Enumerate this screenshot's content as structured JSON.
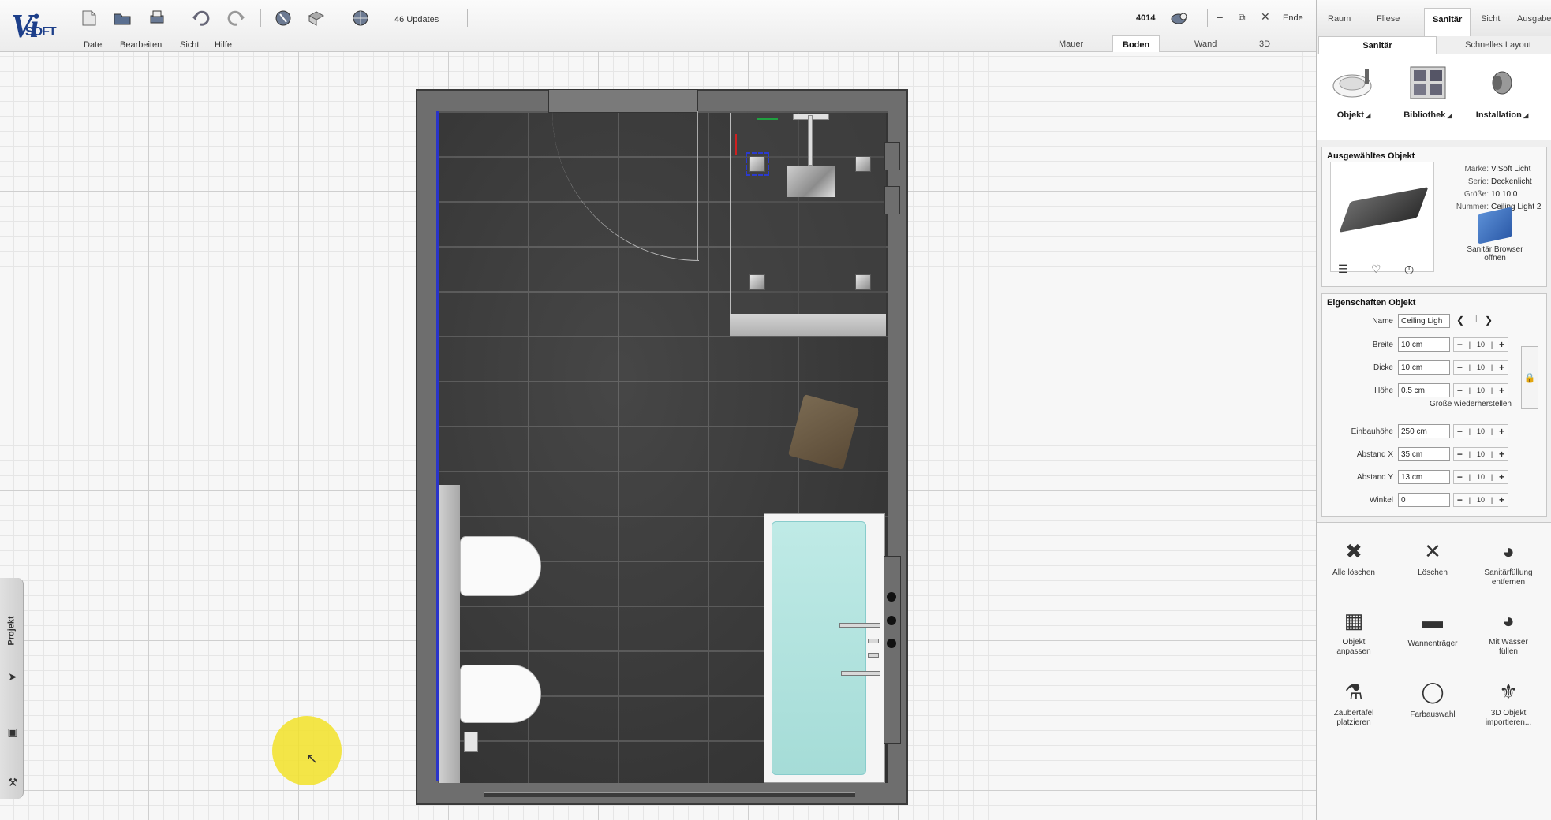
{
  "app": {
    "logo_text_v": "Vi",
    "logo_text_soft": "SOFT",
    "updates_label": "46 Updates",
    "counter": "4014",
    "exit_label": "Ende"
  },
  "menu": [
    "Datei",
    "Bearbeiten",
    "Sicht",
    "Hilfe"
  ],
  "view_tabs": [
    "Mauer",
    "Boden",
    "Wand",
    "3D"
  ],
  "view_tab_active": "Boden",
  "right_tabs": [
    "Raum",
    "Fliese",
    "Sanitär",
    "Sicht",
    "Ausgabe"
  ],
  "right_tab_active": "Sanitär",
  "sub_tabs": [
    "Sanitär",
    "Schnelles Layout"
  ],
  "ribbon": [
    {
      "label": "Objekt",
      "icon": "sink-icon"
    },
    {
      "label": "Bibliothek",
      "icon": "library-icon"
    },
    {
      "label": "Installation",
      "icon": "pipe-icon"
    }
  ],
  "selected": {
    "title": "Ausgewähltes Objekt",
    "meta": [
      {
        "k": "Marke:",
        "v": "ViSoft Licht"
      },
      {
        "k": "Serie:",
        "v": "Deckenlicht"
      },
      {
        "k": "Größe:",
        "v": "10;10;0"
      },
      {
        "k": "Nummer:",
        "v": "Ceiling Light 2"
      }
    ],
    "browser_label_1": "Sanitär Browser",
    "browser_label_2": "öffnen",
    "icons": [
      "list-icon",
      "heart-icon",
      "clock-icon"
    ]
  },
  "properties": {
    "title": "Eigenschaften Objekt",
    "name_label": "Name",
    "name_value": "Ceiling Ligh",
    "rows1": [
      {
        "label": "Breite",
        "value": "10 cm",
        "step": "10"
      },
      {
        "label": "Dicke",
        "value": "10 cm",
        "step": "10"
      },
      {
        "label": "Höhe",
        "value": "0.5 cm",
        "step": "10"
      }
    ],
    "restore_label": "Größe wiederherstellen",
    "rows2": [
      {
        "label": "Einbauhöhe",
        "value": "250 cm",
        "step": "10"
      },
      {
        "label": "Abstand X",
        "value": "35 cm",
        "step": "10"
      },
      {
        "label": "Abstand Y",
        "value": "13 cm",
        "step": "10"
      },
      {
        "label": "Winkel",
        "value": "0",
        "step": "10"
      }
    ]
  },
  "actions": [
    {
      "l1": "Alle löschen",
      "l2": "",
      "icon": "delete-all-icon"
    },
    {
      "l1": "Löschen",
      "l2": "",
      "icon": "delete-icon"
    },
    {
      "l1": "Sanitärfüllung",
      "l2": "entfernen",
      "icon": "remove-fill-icon"
    },
    {
      "l1": "Objekt",
      "l2": "anpassen",
      "icon": "adjust-object-icon"
    },
    {
      "l1": "Wannenträger",
      "l2": "",
      "icon": "tub-support-icon"
    },
    {
      "l1": "Mit Wasser",
      "l2": "füllen",
      "icon": "fill-water-icon"
    },
    {
      "l1": "Zaubertafel",
      "l2": "platzieren",
      "icon": "magic-board-icon"
    },
    {
      "l1": "Farbauswahl",
      "l2": "",
      "icon": "color-picker-icon"
    },
    {
      "l1": "3D Objekt",
      "l2": "importieren...",
      "icon": "import-3d-icon"
    }
  ],
  "left_tab": "Projekt",
  "colors": {
    "accent_blue": "#1d3f8a",
    "selection_blue": "#2a3ad0",
    "highlight_yellow": "#f2e228"
  }
}
